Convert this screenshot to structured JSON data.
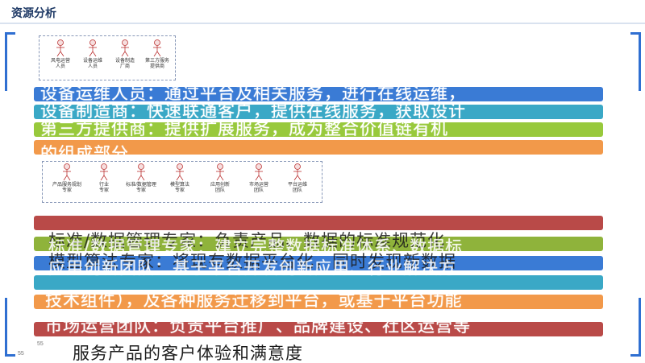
{
  "header": {
    "title": "资源分析"
  },
  "page_numbers": {
    "inner": "55",
    "outer": "55"
  },
  "roles_top": [
    {
      "label": "风电运营\n人员"
    },
    {
      "label": "设备运维\n人员"
    },
    {
      "label": "设备制造\n厂商"
    },
    {
      "label": "第三方服务\n提供商"
    }
  ],
  "roles_mid": [
    {
      "label": "产品服务规划\n专家"
    },
    {
      "label": "行业\n专家"
    },
    {
      "label": "标准/数据管理\n专家"
    },
    {
      "label": "模型算法\n专家"
    },
    {
      "label": "应用创新\n团队"
    },
    {
      "label": "市场运营\n团队"
    },
    {
      "label": "平台运维\n团队"
    }
  ],
  "lines": {
    "l1": "设备运维人员：通过平台及相关服务，进行在线运维，",
    "l2": "设备制造商：快速联通客户，提供在线服务，获取设计",
    "l3": "第三方提供商：提供扩展服务，成为整合价值链有机",
    "l4": "的组成部分",
    "l5a": "标准/数据管理专家：负责产品、数据的标准规范化",
    "l5b": "标准/数据管理专家：建立完整数据标准体系、数据标",
    "l6a": "模型算法专家：将现有数据平台化，同时发现新数据",
    "l6b": "应用创新团队：基于平台开发创新应用、行业解决方",
    "l7": "技术组件），及各种服务迁移到平台，或基于平台功能",
    "l8": "市场运营团队：负责平台推广、品牌建设、社区运营等",
    "l9": "服务产品的客户体验和满意度"
  },
  "colors": {
    "blue": "#2f6fd1",
    "cyan": "#3aa8c6",
    "green": "#98c93c",
    "orange": "#f2994a",
    "red": "#b94a48",
    "olive": "#8fb33b",
    "navy": "#1f3a66"
  }
}
